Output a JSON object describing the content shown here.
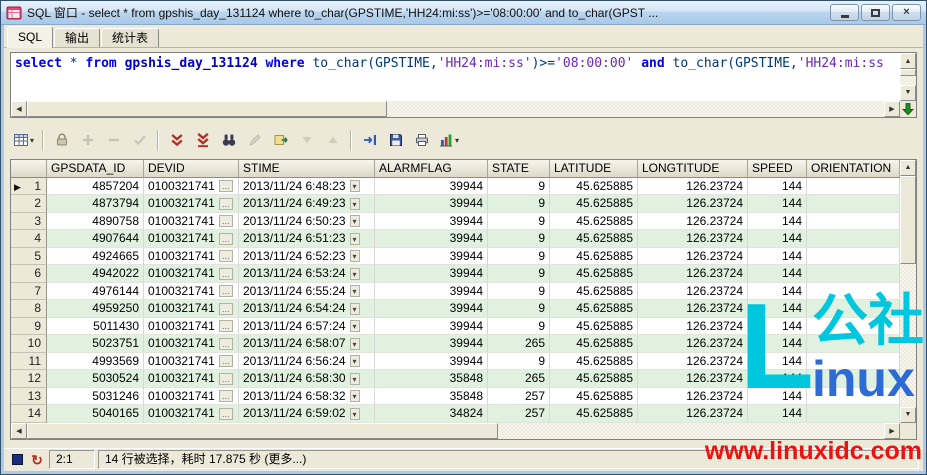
{
  "window": {
    "title": "SQL 窗口 - select * from gpshis_day_131124 where to_char(GPSTIME,'HH24:mi:ss')>='08:00:00' and to_char(GPST ...",
    "controls": [
      "minimize",
      "maximize",
      "close"
    ]
  },
  "tabs": [
    {
      "id": "sql",
      "label": "SQL",
      "active": true
    },
    {
      "id": "output",
      "label": "输出",
      "active": false
    },
    {
      "id": "statistics",
      "label": "统计表",
      "active": false
    }
  ],
  "sql_editor": {
    "segments": [
      {
        "t": "select",
        "c": "kw"
      },
      {
        "t": " * ",
        "c": "pl"
      },
      {
        "t": "from",
        "c": "kw"
      },
      {
        "t": " gpshis_day_131124 ",
        "c": "id"
      },
      {
        "t": "where",
        "c": "kw"
      },
      {
        "t": " to_char(GPSTIME,",
        "c": "pl"
      },
      {
        "t": "'HH24:mi:ss'",
        "c": "str"
      },
      {
        "t": ")>=",
        "c": "pl"
      },
      {
        "t": "'08:00:00'",
        "c": "str"
      },
      {
        "t": " ",
        "c": "pl"
      },
      {
        "t": "and",
        "c": "kw"
      },
      {
        "t": " to_char(GPSTIME,",
        "c": "pl"
      },
      {
        "t": "'HH24:mi:ss",
        "c": "str"
      }
    ]
  },
  "toolbar": {
    "buttons": [
      {
        "name": "grid-mode-button",
        "glyph": "grid",
        "dropdown": true,
        "enabled": true
      },
      {
        "sep": true
      },
      {
        "name": "lock-record-button",
        "glyph": "lock",
        "enabled": true
      },
      {
        "name": "insert-record-button",
        "glyph": "plus",
        "enabled": false
      },
      {
        "name": "delete-record-button",
        "glyph": "minus",
        "enabled": false
      },
      {
        "name": "post-changes-button",
        "glyph": "check",
        "enabled": false
      },
      {
        "sep": true
      },
      {
        "name": "fetch-next-page-button",
        "glyph": "dbl-down",
        "enabled": true
      },
      {
        "name": "fetch-all-button",
        "glyph": "dbl-down-bar",
        "enabled": true
      },
      {
        "name": "find-button",
        "glyph": "binoculars",
        "enabled": true
      },
      {
        "name": "edit-data-button",
        "glyph": "pencil",
        "enabled": false
      },
      {
        "name": "export-data-button",
        "glyph": "export",
        "enabled": true
      },
      {
        "name": "sort-descending-button",
        "glyph": "tri-down",
        "enabled": false
      },
      {
        "name": "sort-ascending-button",
        "glyph": "tri-up",
        "enabled": false
      },
      {
        "sep": true
      },
      {
        "name": "goto-statement-button",
        "glyph": "goto",
        "enabled": true
      },
      {
        "name": "save-results-button",
        "glyph": "disk",
        "enabled": true
      },
      {
        "name": "print-button",
        "glyph": "printer",
        "enabled": true
      },
      {
        "name": "chart-button",
        "glyph": "chart",
        "dropdown": true,
        "enabled": true
      }
    ]
  },
  "grid": {
    "columns": [
      "GPSDATA_ID",
      "DEVID",
      "STIME",
      "ALARMFLAG",
      "STATE",
      "LATITUDE",
      "LONGTITUDE",
      "SPEED",
      "ORIENTATION"
    ],
    "rows": [
      {
        "num": 1,
        "current": true,
        "gpsdata_id": "4857204",
        "devid": "0100321741",
        "stime": "2013/11/24 6:48:23",
        "alarmflag": "39944",
        "state": "9",
        "latitude": "45.625885",
        "longtitude": "126.23724",
        "speed": "144",
        "orientation": ""
      },
      {
        "num": 2,
        "gpsdata_id": "4873794",
        "devid": "0100321741",
        "stime": "2013/11/24 6:49:23",
        "alarmflag": "39944",
        "state": "9",
        "latitude": "45.625885",
        "longtitude": "126.23724",
        "speed": "144",
        "orientation": ""
      },
      {
        "num": 3,
        "gpsdata_id": "4890758",
        "devid": "0100321741",
        "stime": "2013/11/24 6:50:23",
        "alarmflag": "39944",
        "state": "9",
        "latitude": "45.625885",
        "longtitude": "126.23724",
        "speed": "144",
        "orientation": ""
      },
      {
        "num": 4,
        "gpsdata_id": "4907644",
        "devid": "0100321741",
        "stime": "2013/11/24 6:51:23",
        "alarmflag": "39944",
        "state": "9",
        "latitude": "45.625885",
        "longtitude": "126.23724",
        "speed": "144",
        "orientation": ""
      },
      {
        "num": 5,
        "gpsdata_id": "4924665",
        "devid": "0100321741",
        "stime": "2013/11/24 6:52:23",
        "alarmflag": "39944",
        "state": "9",
        "latitude": "45.625885",
        "longtitude": "126.23724",
        "speed": "144",
        "orientation": ""
      },
      {
        "num": 6,
        "gpsdata_id": "4942022",
        "devid": "0100321741",
        "stime": "2013/11/24 6:53:24",
        "alarmflag": "39944",
        "state": "9",
        "latitude": "45.625885",
        "longtitude": "126.23724",
        "speed": "144",
        "orientation": ""
      },
      {
        "num": 7,
        "gpsdata_id": "4976144",
        "devid": "0100321741",
        "stime": "2013/11/24 6:55:24",
        "alarmflag": "39944",
        "state": "9",
        "latitude": "45.625885",
        "longtitude": "126.23724",
        "speed": "144",
        "orientation": ""
      },
      {
        "num": 8,
        "gpsdata_id": "4959250",
        "devid": "0100321741",
        "stime": "2013/11/24 6:54:24",
        "alarmflag": "39944",
        "state": "9",
        "latitude": "45.625885",
        "longtitude": "126.23724",
        "speed": "144",
        "orientation": ""
      },
      {
        "num": 9,
        "gpsdata_id": "5011430",
        "devid": "0100321741",
        "stime": "2013/11/24 6:57:24",
        "alarmflag": "39944",
        "state": "9",
        "latitude": "45.625885",
        "longtitude": "126.23724",
        "speed": "144",
        "orientation": ""
      },
      {
        "num": 10,
        "gpsdata_id": "5023751",
        "devid": "0100321741",
        "stime": "2013/11/24 6:58:07",
        "alarmflag": "39944",
        "state": "265",
        "latitude": "45.625885",
        "longtitude": "126.23724",
        "speed": "144",
        "orientation": ""
      },
      {
        "num": 11,
        "gpsdata_id": "4993569",
        "devid": "0100321741",
        "stime": "2013/11/24 6:56:24",
        "alarmflag": "39944",
        "state": "9",
        "latitude": "45.625885",
        "longtitude": "126.23724",
        "speed": "144",
        "orientation": ""
      },
      {
        "num": 12,
        "gpsdata_id": "5030524",
        "devid": "0100321741",
        "stime": "2013/11/24 6:58:30",
        "alarmflag": "35848",
        "state": "265",
        "latitude": "45.625885",
        "longtitude": "126.23724",
        "speed": "144",
        "orientation": ""
      },
      {
        "num": 13,
        "gpsdata_id": "5031246",
        "devid": "0100321741",
        "stime": "2013/11/24 6:58:32",
        "alarmflag": "35848",
        "state": "257",
        "latitude": "45.625885",
        "longtitude": "126.23724",
        "speed": "144",
        "orientation": ""
      },
      {
        "num": 14,
        "gpsdata_id": "5040165",
        "devid": "0100321741",
        "stime": "2013/11/24 6:59:02",
        "alarmflag": "34824",
        "state": "257",
        "latitude": "45.625885",
        "longtitude": "126.23724",
        "speed": "144",
        "orientation": ""
      }
    ]
  },
  "statusbar": {
    "icons": [
      "stop-icon",
      "refresh-icon"
    ],
    "position": "2:1",
    "message": "14 行被选择，耗时 17.875 秒 ",
    "more": "(更多...)"
  },
  "watermark": {
    "logo_l": "L",
    "logo_cjk": "公社",
    "logo_rest": "inux",
    "url": "www.linuxidc.com",
    "cyan": "#00c6de",
    "blue": "#2e6bd4",
    "red": "#f01010"
  }
}
